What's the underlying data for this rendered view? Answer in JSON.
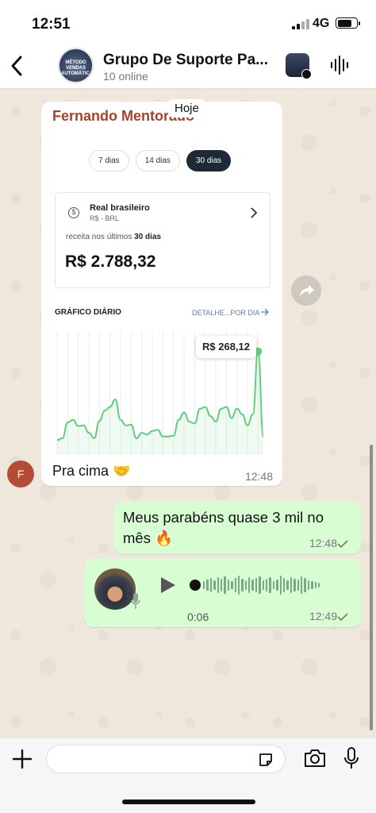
{
  "status": {
    "time": "12:51",
    "network": "4G"
  },
  "header": {
    "group_name": "Grupo De Suporte Pa...",
    "subtitle": "10 online",
    "avatar_text": "MÉTODO VENDAS AUTOMÁTICAS"
  },
  "date_chip": "Hoje",
  "card": {
    "sender": "Fernando Mentorado",
    "pills": [
      "7 dias",
      "14 dias",
      "30 dias"
    ],
    "active_pill": "30 dias",
    "currency_name": "Real brasileiro",
    "currency_code": "R$ - BRL",
    "revenue_label": "receita nos últimos",
    "revenue_period": "30 dias",
    "amount": "R$ 2.788,32",
    "chart_title": "GRÁFICO DIÁRIO",
    "details_link": "DETALHE...POR DIA",
    "tooltip": "R$ 268,12",
    "message": "Pra cima 🤝",
    "time": "12:48"
  },
  "sender_avatar": "F",
  "outgoing": [
    {
      "text": "Meus parabéns quase 3 mil no mês 🔥",
      "time": "12:48"
    },
    {
      "duration": "0:06",
      "time": "12:49"
    }
  ],
  "colors": {
    "outgoing_bubble": "#d8fdd2",
    "chart_line": "#5fcf7c",
    "sender_name": "#a8422b",
    "active_pill": "#1d2a36"
  },
  "chart_data": {
    "type": "area",
    "values": [
      40,
      45,
      88,
      95,
      78,
      80,
      60,
      45,
      92,
      120,
      130,
      150,
      95,
      80,
      82,
      45,
      60,
      55,
      65,
      68,
      50,
      50,
      52,
      95,
      115,
      90,
      85,
      125,
      130,
      105,
      90,
      125,
      130,
      100,
      125,
      110,
      80,
      110,
      280,
      50
    ],
    "tooltip_value": "R$ 268,12"
  }
}
